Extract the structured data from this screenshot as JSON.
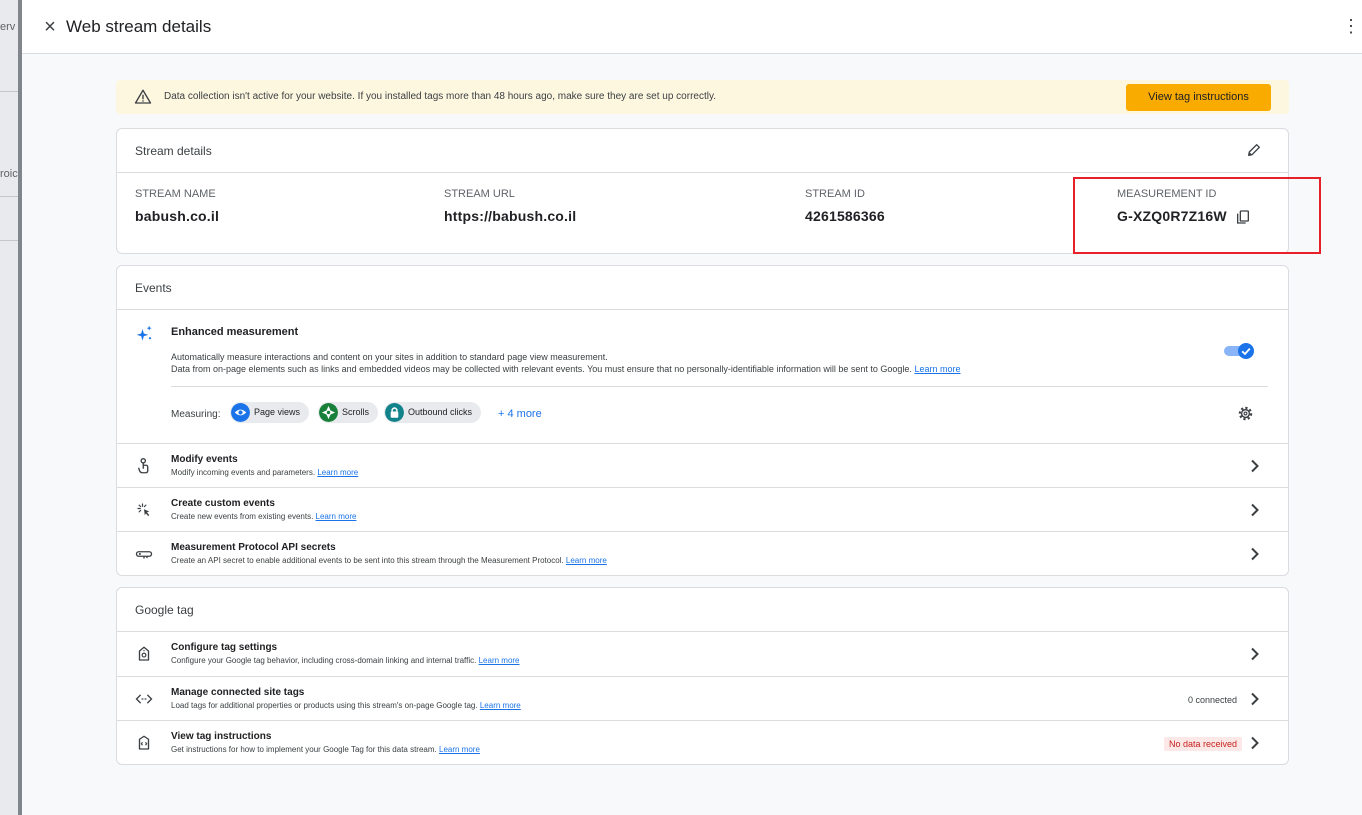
{
  "background": {
    "fragment_top": "erv",
    "fragment_mid": "roic"
  },
  "header": {
    "close_glyph": "×",
    "title": "Web stream details",
    "more_glyph": "⋮"
  },
  "banner": {
    "message": "Data collection isn't active for your website. If you installed tags more than 48 hours ago, make sure they are set up correctly.",
    "button_label": "View tag instructions"
  },
  "stream_details": {
    "heading": "Stream details",
    "name_label": "STREAM NAME",
    "name_value": "babush.co.il",
    "url_label": "STREAM URL",
    "url_value": "https://babush.co.il",
    "id_label": "STREAM ID",
    "id_value": "4261586366",
    "measurement_label": "MEASUREMENT ID",
    "measurement_value": "G-XZQ0R7Z16W"
  },
  "events": {
    "heading": "Events",
    "enhanced": {
      "title": "Enhanced measurement",
      "desc1": "Automatically measure interactions and content on your sites in addition to standard page view measurement.",
      "desc2": "Data from on-page elements such as links and embedded videos may be collected with relevant events. You must ensure that no personally-identifiable information will be sent to Google.",
      "learn_more": "Learn more",
      "toggle_on": true,
      "measuring_label": "Measuring:",
      "chips": [
        "Page views",
        "Scrolls",
        "Outbound clicks"
      ],
      "more_label": "+ 4 more"
    },
    "rows": [
      {
        "title": "Modify events",
        "desc": "Modify incoming events and parameters.",
        "link": "Learn more"
      },
      {
        "title": "Create custom events",
        "desc": "Create new events from existing events.",
        "link": "Learn more"
      },
      {
        "title": "Measurement Protocol API secrets",
        "desc": "Create an API secret to enable additional events to be sent into this stream through the Measurement Protocol.",
        "link": "Learn more"
      }
    ]
  },
  "google_tag": {
    "heading": "Google tag",
    "rows": [
      {
        "title": "Configure tag settings",
        "desc": "Configure your Google tag behavior, including cross-domain linking and internal traffic.",
        "link": "Learn more",
        "badge": ""
      },
      {
        "title": "Manage connected site tags",
        "desc": "Load tags for additional properties or products using this stream's on-page Google tag.",
        "link": "Learn more",
        "badge": "0 connected"
      },
      {
        "title": "View tag instructions",
        "desc": "Get instructions for how to implement your Google Tag for this data stream.",
        "link": "Learn more",
        "badge": "No data received"
      }
    ]
  },
  "colors": {
    "accent": "#1a73e8",
    "warning_bg": "#fef7e0",
    "button_amber": "#f9ab00",
    "highlight_red": "#e8202a",
    "nodata_red": "#c5221f",
    "nodata_bg": "#fce8e6"
  }
}
